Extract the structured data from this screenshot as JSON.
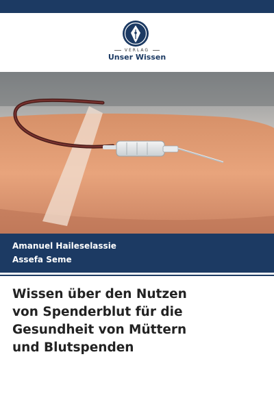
{
  "publisher": {
    "imprint": "VERLAG",
    "name": "Unser Wissen"
  },
  "cover_image": {
    "subject": "blood donation needle in arm"
  },
  "authors": [
    "Amanuel Haileselassie",
    "Assefa Seme"
  ],
  "title_lines": [
    "Wissen über den Nutzen",
    "von Spenderblut für die",
    "Gesundheit von Müttern",
    "und Blutspenden"
  ],
  "colors": {
    "brand_navy": "#1c3a63",
    "title_text": "#222222"
  }
}
